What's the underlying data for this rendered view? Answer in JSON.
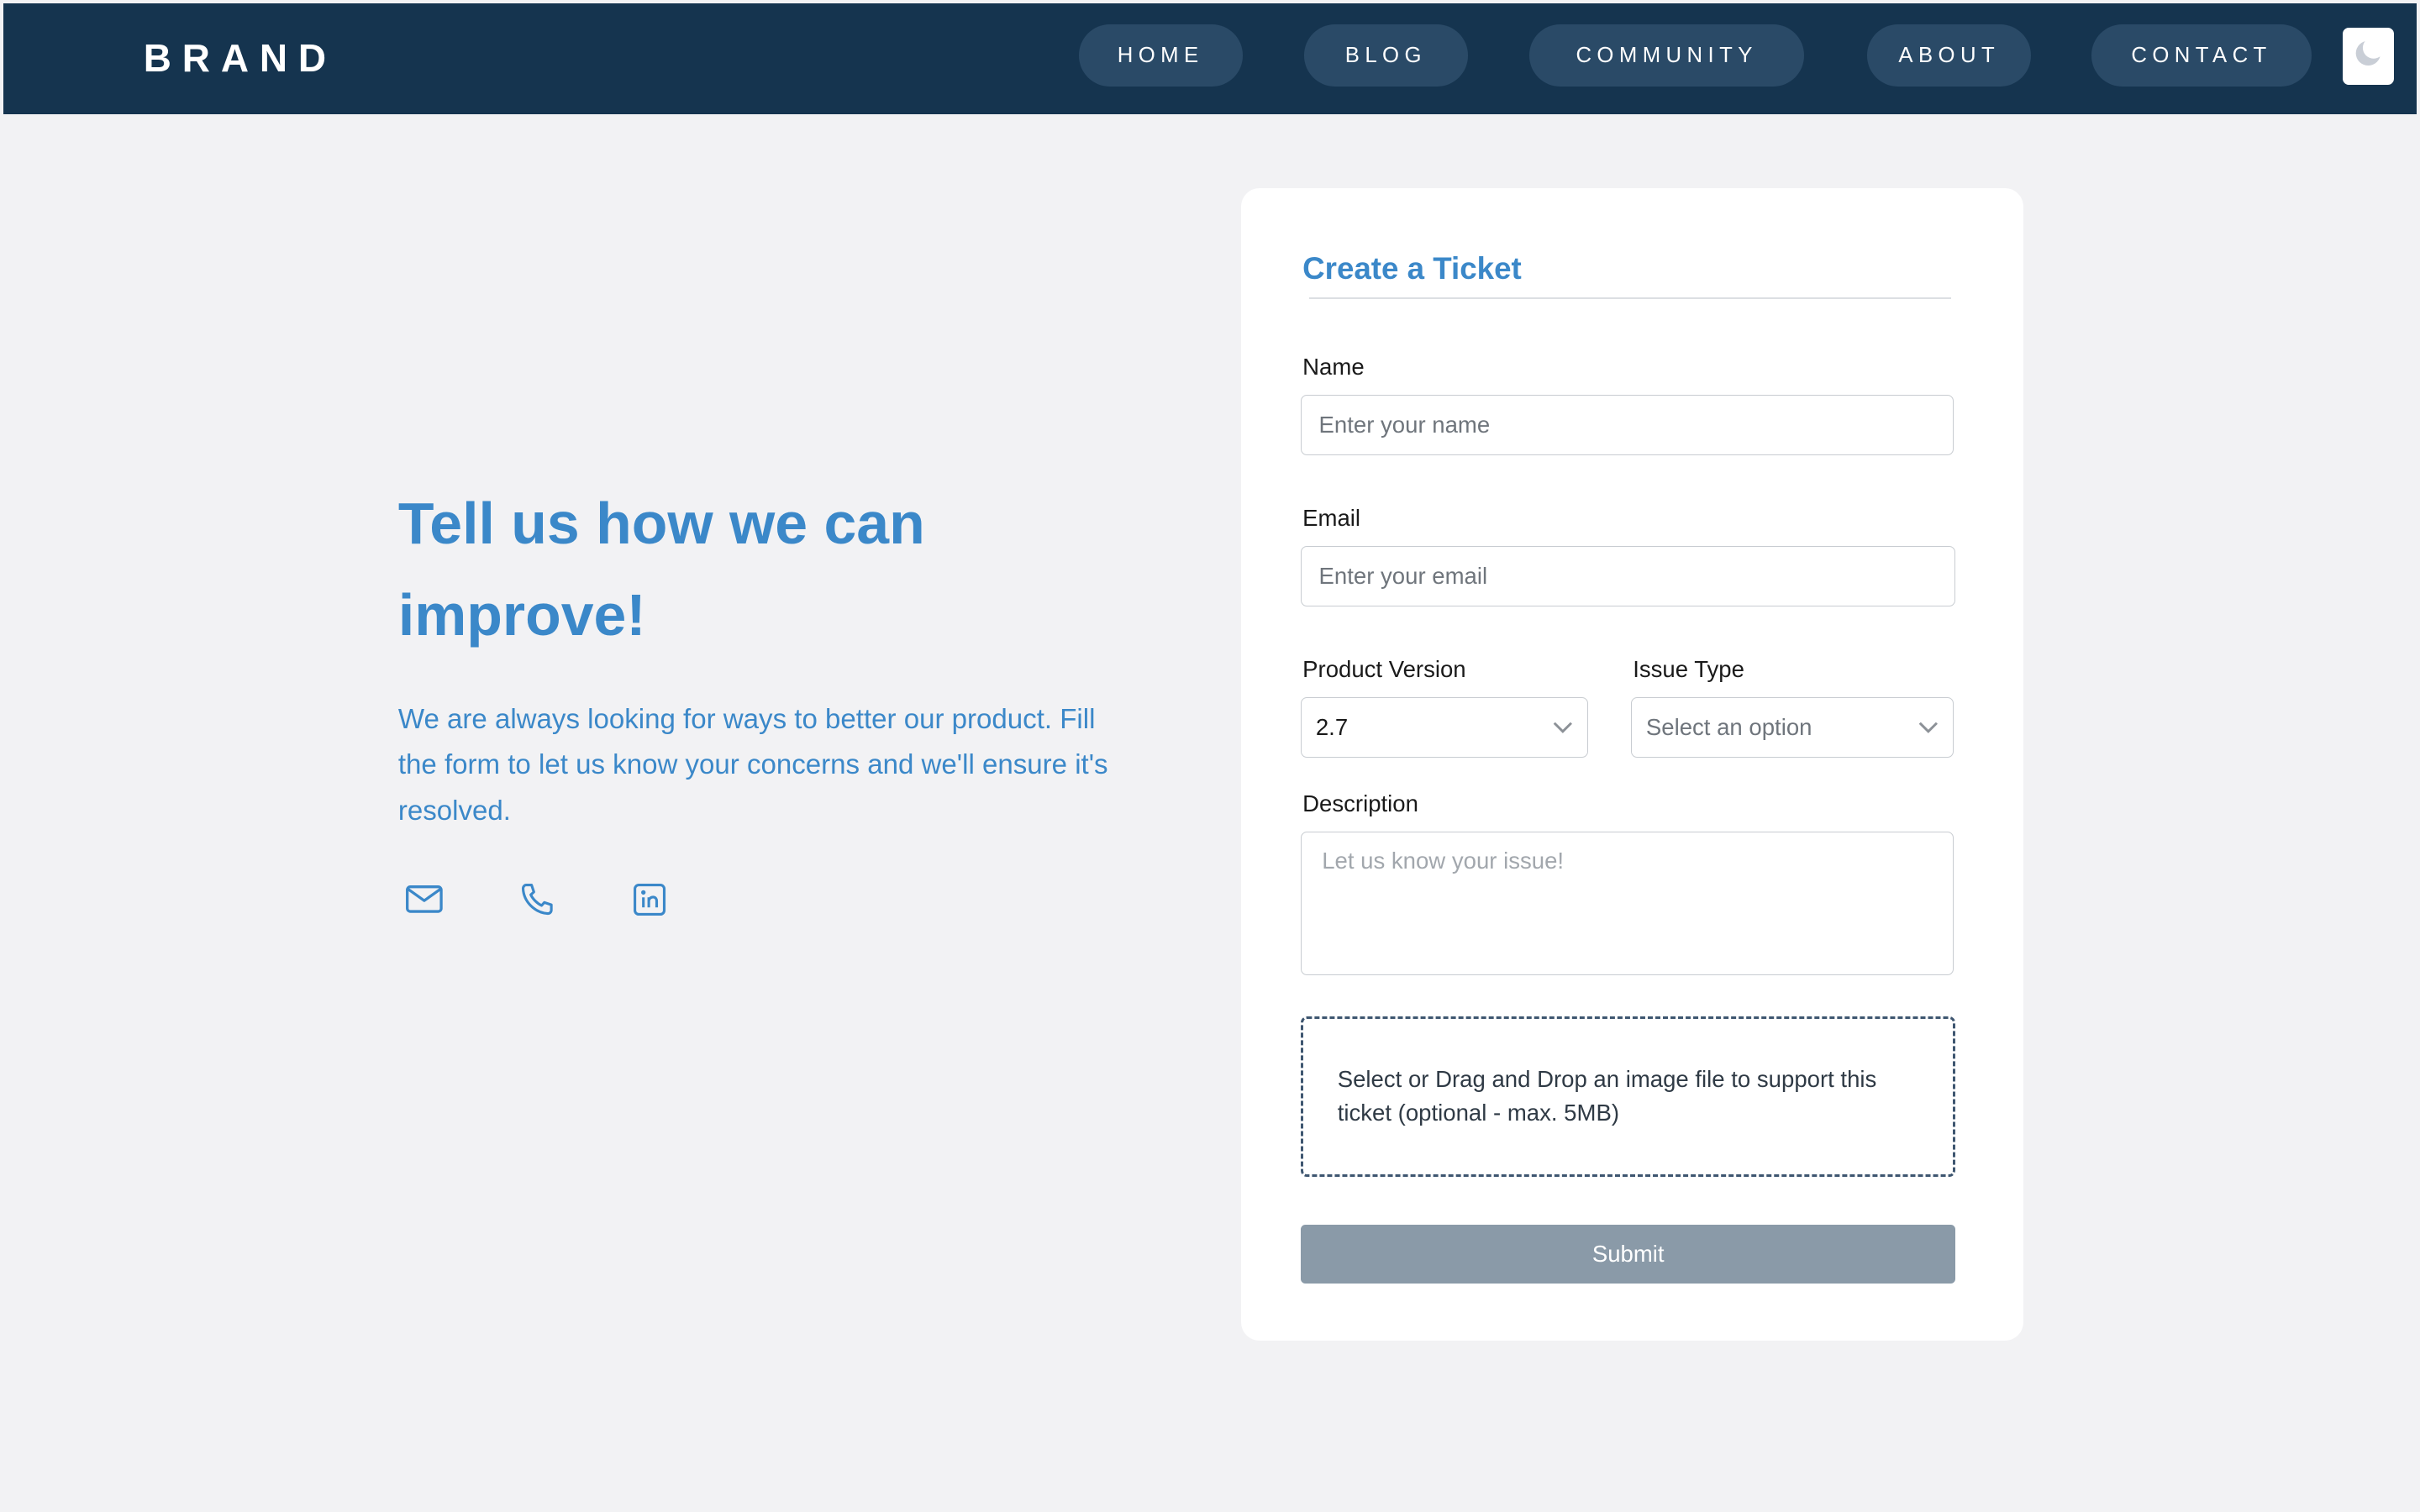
{
  "nav": {
    "brand": "BRAND",
    "items": [
      {
        "label": "HOME"
      },
      {
        "label": "BLOG"
      },
      {
        "label": "COMMUNITY"
      },
      {
        "label": "ABOUT"
      },
      {
        "label": "CONTACT"
      }
    ],
    "theme_toggle_icon": "moon-icon"
  },
  "hero": {
    "title": "Tell us how we can improve!",
    "text": "We are always looking for ways to better our product. Fill the form to let us know your concerns and we'll ensure it's resolved.",
    "icons": [
      "mail-icon",
      "phone-icon",
      "linkedin-icon"
    ]
  },
  "form": {
    "title": "Create a Ticket",
    "name": {
      "label": "Name",
      "placeholder": "Enter your name",
      "value": ""
    },
    "email": {
      "label": "Email",
      "placeholder": "Enter your email",
      "value": ""
    },
    "product_version": {
      "label": "Product Version",
      "value": "2.7"
    },
    "issue_type": {
      "label": "Issue Type",
      "placeholder": "Select an option"
    },
    "description": {
      "label": "Description",
      "placeholder": "Let us know your issue!"
    },
    "dropzone_text": "Select or Drag and Drop an image file to support this ticket (optional - max. 5MB)",
    "submit_label": "Submit"
  },
  "colors": {
    "nav_background": "#15344f",
    "nav_pill": "#2a4a67",
    "accent": "#3b88c9",
    "page_background": "#f2f2f4",
    "submit_disabled": "#8a9aa8"
  }
}
